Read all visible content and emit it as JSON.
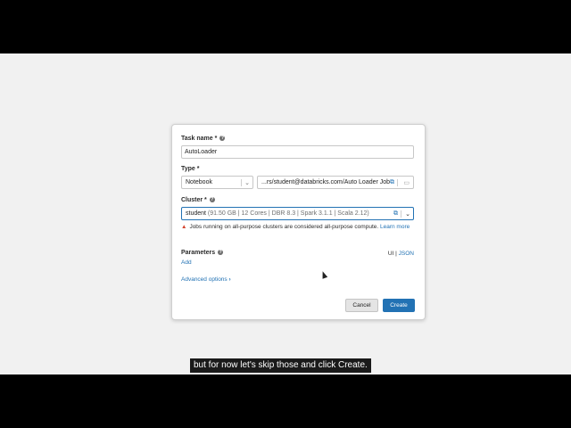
{
  "form": {
    "task_name_label": "Task name *",
    "task_name_value": "AutoLoader",
    "type_label": "Type *",
    "type_value": "Notebook",
    "notebook_path": "...rs/student@databricks.com/Auto Loader Job",
    "cluster_label": "Cluster *",
    "cluster_name": "student",
    "cluster_meta": " (91.50 GB | 12 Cores | DBR 8.3 | Spark 3.1.1 | Scala 2.12)",
    "warning_text": "Jobs running on all-purpose clusters are considered all-purpose compute.",
    "warning_link": "Learn more",
    "parameters_label": "Parameters",
    "parameters_add": "Add",
    "mode_ui": "UI",
    "mode_sep": "|",
    "mode_json": "JSON",
    "advanced_label": "Advanced options",
    "cancel_label": "Cancel",
    "create_label": "Create"
  },
  "caption": "but for now let's skip those and click Create.",
  "icons": {
    "help": "?",
    "chevron": "⌄",
    "external": "⧉",
    "folder": "▭",
    "warning": "▲",
    "advanced_chevron": "›"
  },
  "colors": {
    "accent": "#2272b4",
    "warning": "#d4452f"
  }
}
